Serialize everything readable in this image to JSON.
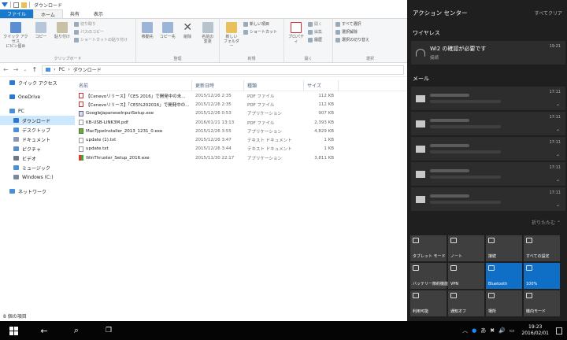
{
  "explorer": {
    "title": "ダウンロード",
    "tabs": [
      "ファイル",
      "ホーム",
      "共有",
      "表示"
    ],
    "ribbon": {
      "clipboard": {
        "label": "クリップボード",
        "pin": "クイック アクセス\nにピン留め",
        "copy": "コピー",
        "paste": "貼り付け",
        "cut": "切り取り",
        "copy_path": "パスのコピー",
        "paste_shortcut": "ショートカットの貼り付け"
      },
      "organize": {
        "label": "整理",
        "move_to": "移動先",
        "copy_to": "コピー先",
        "delete": "削除",
        "rename": "名前の\n変更"
      },
      "new": {
        "label": "新規",
        "new_folder": "新しい\nフォルダー",
        "new_item": "新しい項目",
        "shortcut": "ショートカット"
      },
      "open": {
        "label": "開く",
        "properties": "プロパティ",
        "open": "開く",
        "edit": "編集",
        "history": "履歴"
      },
      "select": {
        "label": "選択",
        "select_all": "すべて選択",
        "select_none": "選択解除",
        "invert": "選択の切り替え"
      }
    },
    "address": {
      "pc": "PC",
      "folder": "ダウンロード"
    },
    "nav": [
      {
        "label": "クイック アクセス",
        "icon": "star-icon",
        "color": "#2b79d0"
      },
      {
        "label": "OneDrive",
        "icon": "cloud-icon",
        "color": "#2b79d0"
      },
      {
        "label": "PC",
        "icon": "pc-icon",
        "color": "#4a90d9"
      },
      {
        "label": "ダウンロード",
        "icon": "download-icon",
        "color": "#2b79d0"
      },
      {
        "label": "デスクトップ",
        "icon": "desktop-icon",
        "color": "#4a90d9"
      },
      {
        "label": "ドキュメント",
        "icon": "document-icon",
        "color": "#8a9ab0"
      },
      {
        "label": "ピクチャ",
        "icon": "pictures-icon",
        "color": "#5a8ec9"
      },
      {
        "label": "ビデオ",
        "icon": "video-icon",
        "color": "#6a7a8a"
      },
      {
        "label": "ミュージック",
        "icon": "music-icon",
        "color": "#4a90d9"
      },
      {
        "label": "Windows (C:)",
        "icon": "drive-icon",
        "color": "#7a8a9a"
      },
      {
        "label": "ネットワーク",
        "icon": "network-icon",
        "color": "#4a90d9"
      }
    ],
    "columns": {
      "name": "名前",
      "date": "更新日時",
      "type": "種類",
      "size": "サイズ"
    },
    "files": [
      {
        "name": "【Cenevoリリース】「CES 2016」で開発中の未...",
        "date": "2015/12/26 2:35",
        "type": "PDF ファイル",
        "size": "112 KB",
        "icon": "pdf"
      },
      {
        "name": "【Cenevoリリース】「CES%202016」で開発中の...",
        "date": "2015/12/26 2:35",
        "type": "PDF ファイル",
        "size": "112 KB",
        "icon": "pdf"
      },
      {
        "name": "GoogleJapaneseInputSetup.exe",
        "date": "2015/12/26 0:53",
        "type": "アプリケーション",
        "size": "907 KB",
        "icon": "exe"
      },
      {
        "name": "KB-USB-LINK3M.pdf",
        "date": "2016/01/21 13:13",
        "type": "PDF ファイル",
        "size": "2,393 KB",
        "icon": "doc"
      },
      {
        "name": "MacTypeInstaller_2013_1231_0.exe",
        "date": "2015/12/26 3:55",
        "type": "アプリケーション",
        "size": "4,829 KB",
        "icon": "mac"
      },
      {
        "name": "update (1).txt",
        "date": "2015/12/26 3:47",
        "type": "テキスト ドキュメント",
        "size": "1 KB",
        "icon": "doc"
      },
      {
        "name": "update.txt",
        "date": "2015/12/26 3:44",
        "type": "テキスト ドキュメント",
        "size": "1 KB",
        "icon": "doc"
      },
      {
        "name": "WinThruster_Setup_2016.exe",
        "date": "2015/11/30 22:17",
        "type": "アプリケーション",
        "size": "3,811 KB",
        "icon": "win"
      }
    ],
    "status": "8 個の項目"
  },
  "action_center": {
    "title": "アクション センター",
    "clear_all": "すべてクリア",
    "wireless": {
      "section": "ワイヤレス",
      "title": "Wi2 の確認が必要です",
      "subtitle": "接続",
      "time": "19:21"
    },
    "mail": {
      "section": "メール",
      "times": [
        "17:11",
        "17:11",
        "17:11",
        "17:11",
        "17:11"
      ]
    },
    "collapse": "折りたたむ ⌃",
    "tiles": [
      {
        "label": "タブレット モード",
        "on": false
      },
      {
        "label": "ノート",
        "on": false
      },
      {
        "label": "接続",
        "on": false
      },
      {
        "label": "すべての設定",
        "on": false
      },
      {
        "label": "バッテリー節約機能",
        "on": false
      },
      {
        "label": "VPN",
        "on": false
      },
      {
        "label": "Bluetooth",
        "on": true
      },
      {
        "label": "100%",
        "on": true
      },
      {
        "label": "利用可能",
        "on": false
      },
      {
        "label": "通知オフ",
        "on": false
      },
      {
        "label": "場所",
        "on": false
      },
      {
        "label": "機内モード",
        "on": false
      }
    ]
  },
  "taskbar": {
    "time": "19:23",
    "date": "2016/02/01",
    "ime": "あ",
    "back": "←",
    "search": "⌕",
    "task_view": "❐",
    "tray": [
      "︿",
      "●",
      "✖",
      "🔊",
      "▭"
    ]
  }
}
